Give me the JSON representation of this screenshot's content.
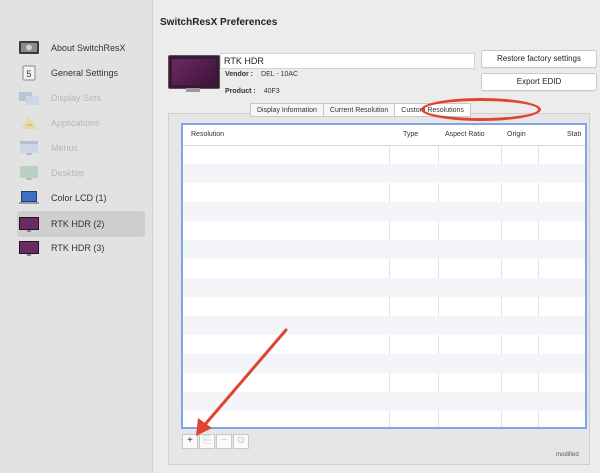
{
  "window": {
    "title": "SwitchResX Preferences"
  },
  "sidebar": {
    "items": [
      {
        "label": "About SwitchResX",
        "icon": "switchresx-app-icon",
        "enabled": true
      },
      {
        "label": "General Settings",
        "icon": "general-settings-icon",
        "enabled": true
      },
      {
        "label": "Display Sets",
        "icon": "display-sets-icon",
        "enabled": false
      },
      {
        "label": "Applications",
        "icon": "applications-icon",
        "enabled": false
      },
      {
        "label": "Menus",
        "icon": "menus-icon",
        "enabled": false
      },
      {
        "label": "Desktop",
        "icon": "desktop-icon",
        "enabled": false
      },
      {
        "label": "Color LCD (1)",
        "icon": "laptop-display-icon",
        "enabled": true
      },
      {
        "label": "RTK HDR (2)",
        "icon": "monitor-icon",
        "enabled": true,
        "selected": true
      },
      {
        "label": "RTK HDR (3)",
        "icon": "monitor-icon",
        "enabled": true
      }
    ]
  },
  "display": {
    "name": "RTK HDR",
    "vendor_label": "Vendor :",
    "vendor_value": "DEL - 10AC",
    "product_label": "Product :",
    "product_value": "40F3"
  },
  "buttons": {
    "restore": "Restore factory settings",
    "export": "Export EDID"
  },
  "tabs": [
    {
      "label": "Display Information",
      "active": false
    },
    {
      "label": "Current Resolution",
      "active": false
    },
    {
      "label": "Custom Resolutions",
      "active": true
    }
  ],
  "table": {
    "columns": [
      "Resolution",
      "Type",
      "Aspect Ratio",
      "Origin",
      "Statı"
    ],
    "rows": []
  },
  "toolbar": {
    "add": "+",
    "duplicate": "⎘",
    "remove": "−",
    "info": "⊙"
  },
  "status_text": "modified",
  "colors": {
    "highlight": "#e0432e",
    "table_focus": "#7ea6e8",
    "monitor": "#6a2a63"
  }
}
